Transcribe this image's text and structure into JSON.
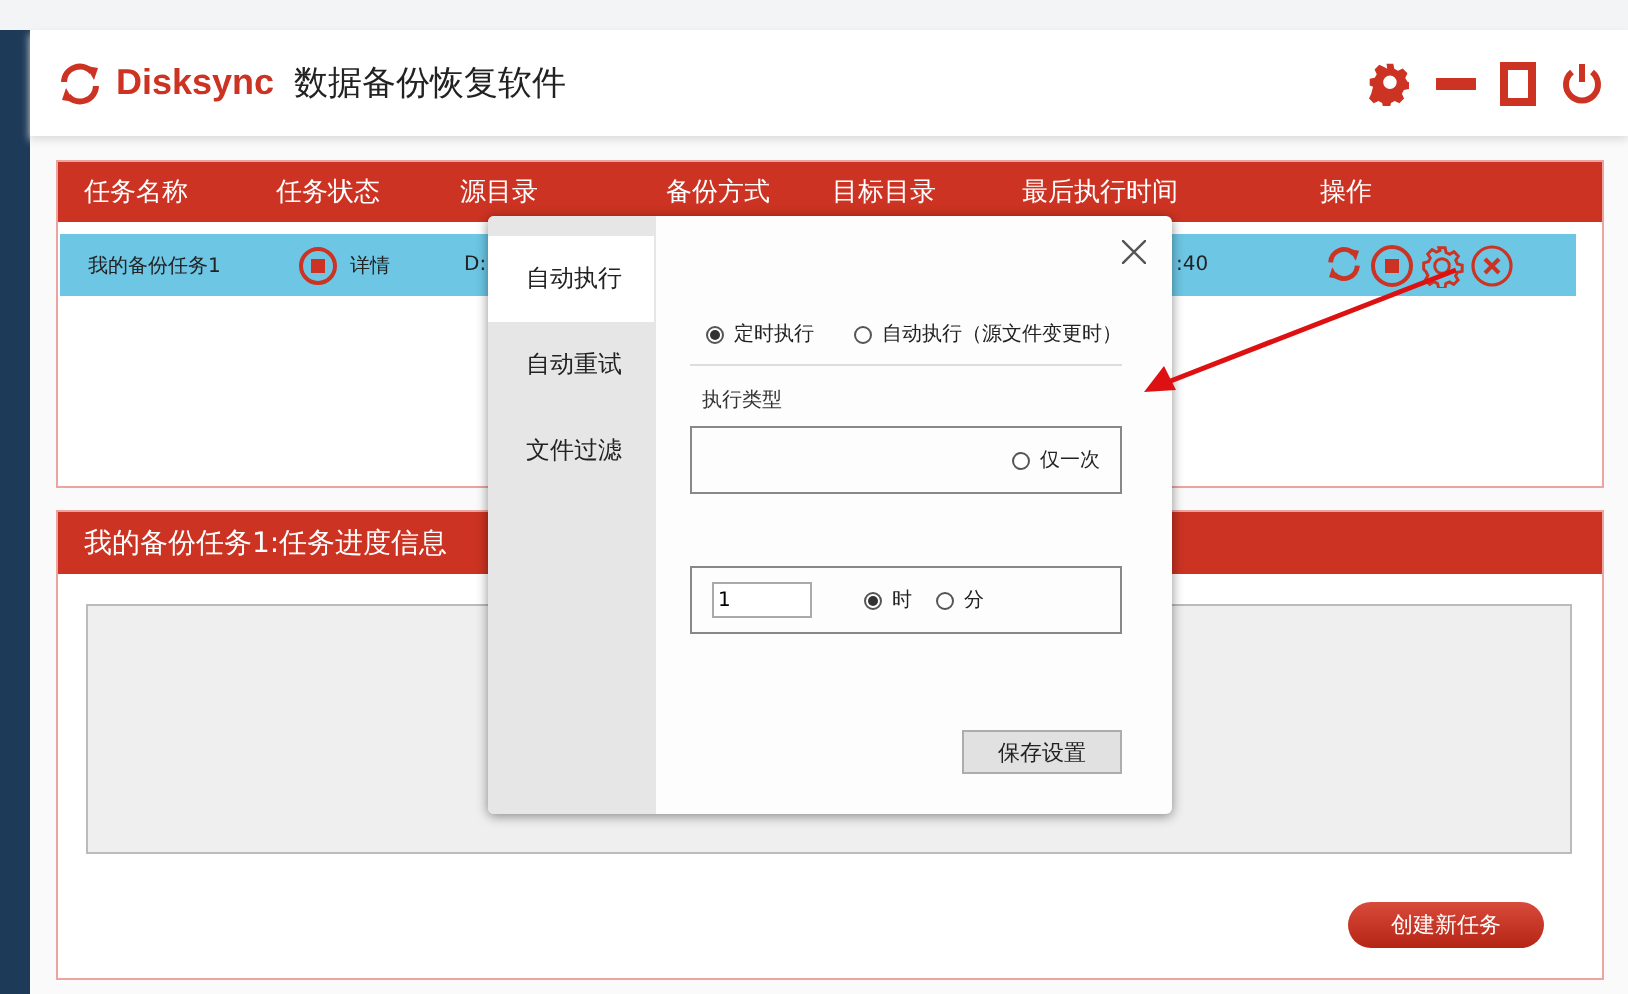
{
  "app": {
    "name": "Disksync",
    "subtitle": "数据备份恢复软件"
  },
  "task_table": {
    "columns": [
      "任务名称",
      "任务状态",
      "源目录",
      "备份方式",
      "目标目录",
      "最后执行时间",
      "操作"
    ],
    "rows": [
      {
        "name": "我的备份任务1",
        "detail_link": "详情",
        "source": "D:",
        "last_run": ":40",
        "selected": true
      }
    ]
  },
  "progress_panel": {
    "title": "我的备份任务1:任务进度信息"
  },
  "create_button": "创建新任务",
  "settings_dialog": {
    "tabs": [
      {
        "label": "自动执行",
        "selected": true
      },
      {
        "label": "自动重试",
        "selected": false
      },
      {
        "label": "文件过滤",
        "selected": false
      }
    ],
    "mode_options": [
      {
        "label": "定时执行",
        "selected": true
      },
      {
        "label": "自动执行（源文件变更时）",
        "selected": false
      }
    ],
    "type_label": "执行类型",
    "type_options": [
      {
        "label": "仅一次",
        "selected": false
      }
    ],
    "interval": {
      "value": "1",
      "units": [
        {
          "label": "时",
          "selected": true
        },
        {
          "label": "分",
          "selected": false
        }
      ]
    },
    "save_button": "保存设置"
  }
}
